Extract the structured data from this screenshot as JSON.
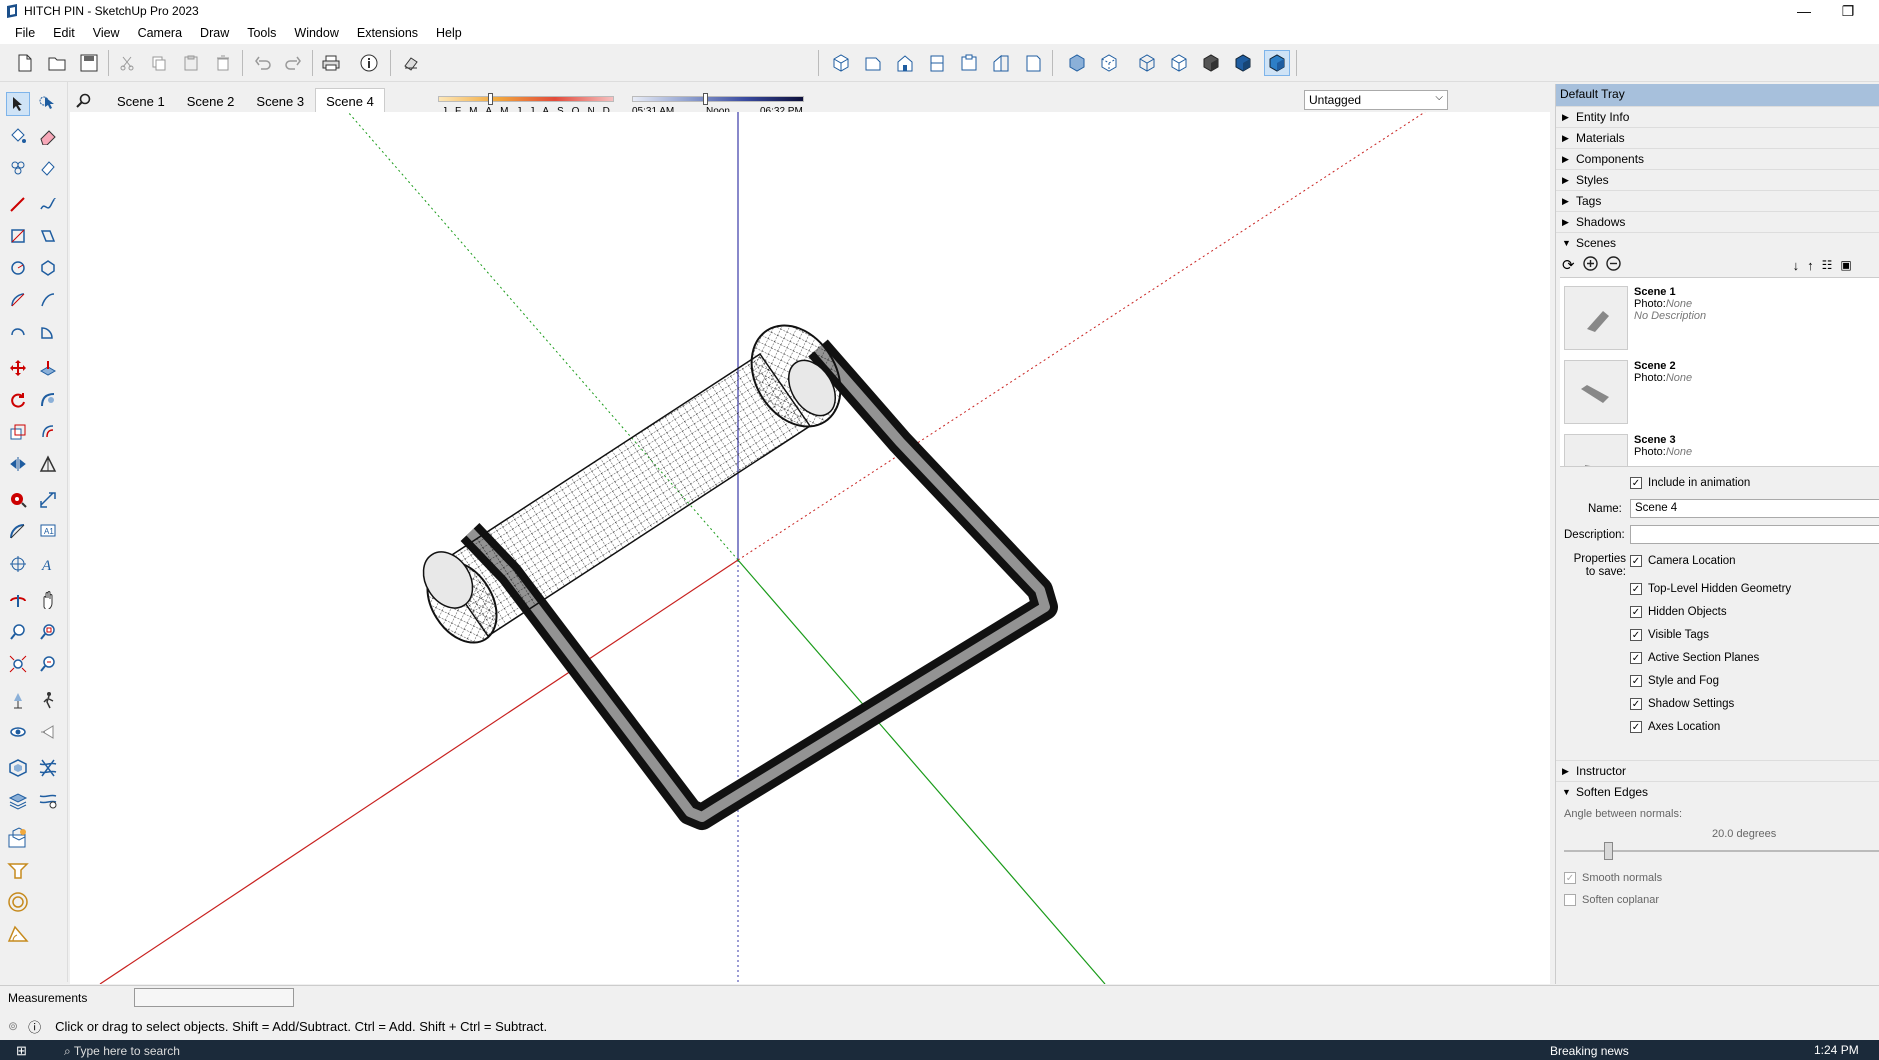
{
  "window": {
    "title": "HITCH PIN - SketchUp Pro 2023"
  },
  "menu": [
    "File",
    "Edit",
    "View",
    "Camera",
    "Draw",
    "Tools",
    "Window",
    "Extensions",
    "Help"
  ],
  "shadow": {
    "months": [
      "J",
      "F",
      "M",
      "A",
      "M",
      "J",
      "J",
      "A",
      "S",
      "O",
      "N",
      "D"
    ],
    "time_start": "05:31 AM",
    "time_mid": "Noon",
    "time_end": "06:32 PM"
  },
  "tag_dropdown": "Untagged",
  "scene_tabs": [
    "Scene 1",
    "Scene 2",
    "Scene 3",
    "Scene 4"
  ],
  "tray": {
    "title": "Default Tray",
    "panels": [
      "Entity Info",
      "Materials",
      "Components",
      "Styles",
      "Tags",
      "Shadows"
    ],
    "scenes_panel": "Scenes",
    "scene_items": [
      {
        "name": "Scene 1",
        "photo_label": "Photo:",
        "photo": "None",
        "desc": "No Description"
      },
      {
        "name": "Scene 2",
        "photo_label": "Photo:",
        "photo": "None",
        "desc": ""
      },
      {
        "name": "Scene 3",
        "photo_label": "Photo:",
        "photo": "None",
        "desc": ""
      }
    ],
    "include_animation": "Include in animation",
    "name_label": "Name:",
    "name_value": "Scene 4",
    "description_label": "Description:",
    "properties_label": "Properties to save:",
    "properties": [
      "Camera Location",
      "Top-Level Hidden Geometry",
      "Hidden Objects",
      "Visible Tags",
      "Active Section Planes",
      "Style and Fog",
      "Shadow Settings",
      "Axes Location"
    ],
    "instructor": "Instructor",
    "soften_edges": "Soften Edges",
    "angle_label": "Angle between normals:",
    "angle_value": "20.0",
    "angle_unit": "degrees",
    "smooth_normals": "Smooth normals",
    "soften_coplanar": "Soften coplanar"
  },
  "measurements_label": "Measurements",
  "status_text": "Click or drag to select objects. Shift = Add/Subtract. Ctrl = Add. Shift + Ctrl = Subtract.",
  "taskbar": {
    "search": "Type here to search",
    "news": "Breaking news",
    "clock": "1:24 PM"
  },
  "colors": {
    "red_axis": "#c8211f",
    "green_axis": "#1a9b1a",
    "blue_axis": "#3a3aa8",
    "tray_header": "#a7c0dc"
  }
}
